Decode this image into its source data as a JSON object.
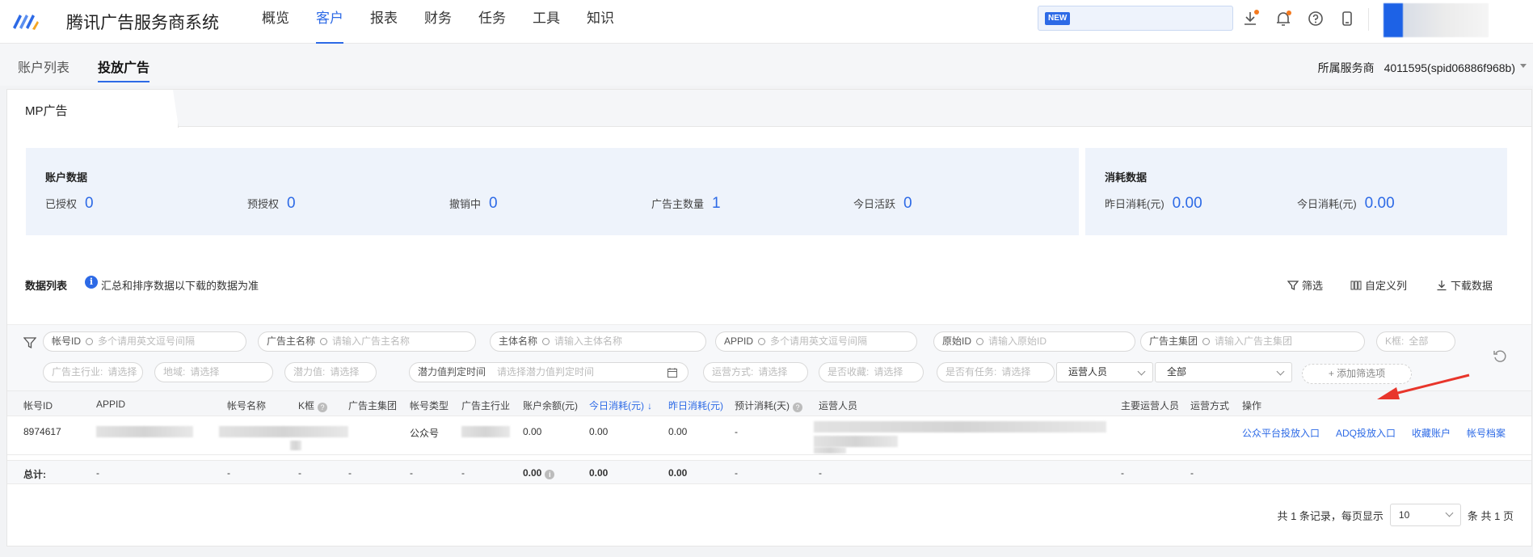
{
  "app": {
    "brand": "腾讯广告服务商系统"
  },
  "nav": {
    "items": [
      "概览",
      "客户",
      "报表",
      "财务",
      "任务",
      "工具",
      "知识"
    ],
    "active": 1
  },
  "header": {
    "new_badge": "NEW"
  },
  "subnav": {
    "tabs": [
      "账户列表",
      "投放广告"
    ],
    "active": 1,
    "provider_label": "所属服务商",
    "provider_value": "4011595(spid06886f968b)"
  },
  "tab": {
    "mp": "MP广告"
  },
  "account_stats": {
    "title": "账户数据",
    "items": [
      {
        "label": "已授权",
        "value": "0"
      },
      {
        "label": "预授权",
        "value": "0"
      },
      {
        "label": "撤销中",
        "value": "0"
      },
      {
        "label": "广告主数量",
        "value": "1"
      },
      {
        "label": "今日活跃",
        "value": "0"
      }
    ]
  },
  "consume_stats": {
    "title": "消耗数据",
    "items": [
      {
        "label": "昨日消耗(元)",
        "value": "0.00"
      },
      {
        "label": "今日消耗(元)",
        "value": "0.00"
      }
    ]
  },
  "list": {
    "title": "数据列表",
    "info": "汇总和排序数据以下载的数据为准",
    "actions": [
      "筛选",
      "自定义列",
      "下载数据"
    ]
  },
  "filters": {
    "row1": [
      {
        "label": "帐号ID",
        "placeholder": "多个请用英文逗号间隔"
      },
      {
        "label": "广告主名称",
        "placeholder": "请输入广告主名称"
      },
      {
        "label": "主体名称",
        "placeholder": "请输入主体名称"
      },
      {
        "label": "APPID",
        "placeholder": "多个请用英文逗号间隔"
      },
      {
        "label": "原始ID",
        "placeholder": "请输入原始ID"
      },
      {
        "label": "广告主集团",
        "placeholder": "请输入广告主集团"
      },
      {
        "label": "K框:",
        "placeholder": "全部"
      }
    ],
    "row2": [
      {
        "label": "广告主行业:",
        "placeholder": "请选择"
      },
      {
        "label": "地域:",
        "placeholder": "请选择"
      },
      {
        "label": "潜力值:",
        "placeholder": "请选择"
      },
      {
        "label": "潜力值判定时间",
        "placeholder": "请选择潜力值判定时间"
      },
      {
        "label": "运营方式:",
        "placeholder": "请选择"
      },
      {
        "label": "是否收藏:",
        "placeholder": "请选择"
      },
      {
        "label": "是否有任务:",
        "placeholder": "请选择"
      }
    ],
    "operator_select": "运营人员",
    "operator_value": "全部",
    "add_filter": "+ 添加筛选项"
  },
  "table": {
    "columns": [
      "帐号ID",
      "APPID",
      "帐号名称",
      "K框",
      "广告主集团",
      "帐号类型",
      "广告主行业",
      "账户余额(元)",
      "今日消耗(元)",
      "昨日消耗(元)",
      "预计消耗(天)",
      "运营人员",
      "主要运营人员",
      "运营方式",
      "操作"
    ],
    "row": {
      "account_id": "8974617",
      "account_type": "公众号",
      "balance": "0.00",
      "today": "0.00",
      "yesterday": "0.00",
      "estimate": "-",
      "links": [
        "公众平台投放入口",
        "ADQ投放入口",
        "收藏账户",
        "帐号档案"
      ]
    },
    "total": {
      "label": "总计:",
      "dash": "-",
      "balance": "0.00",
      "today": "0.00",
      "yesterday": "0.00"
    }
  },
  "pager": {
    "summary": "共 1 条记录，每页显示",
    "page_size": "10",
    "pages": "条 共 1 页"
  },
  "colors": {
    "accent": "#2d6ae6",
    "arrow": "#e8352b"
  }
}
